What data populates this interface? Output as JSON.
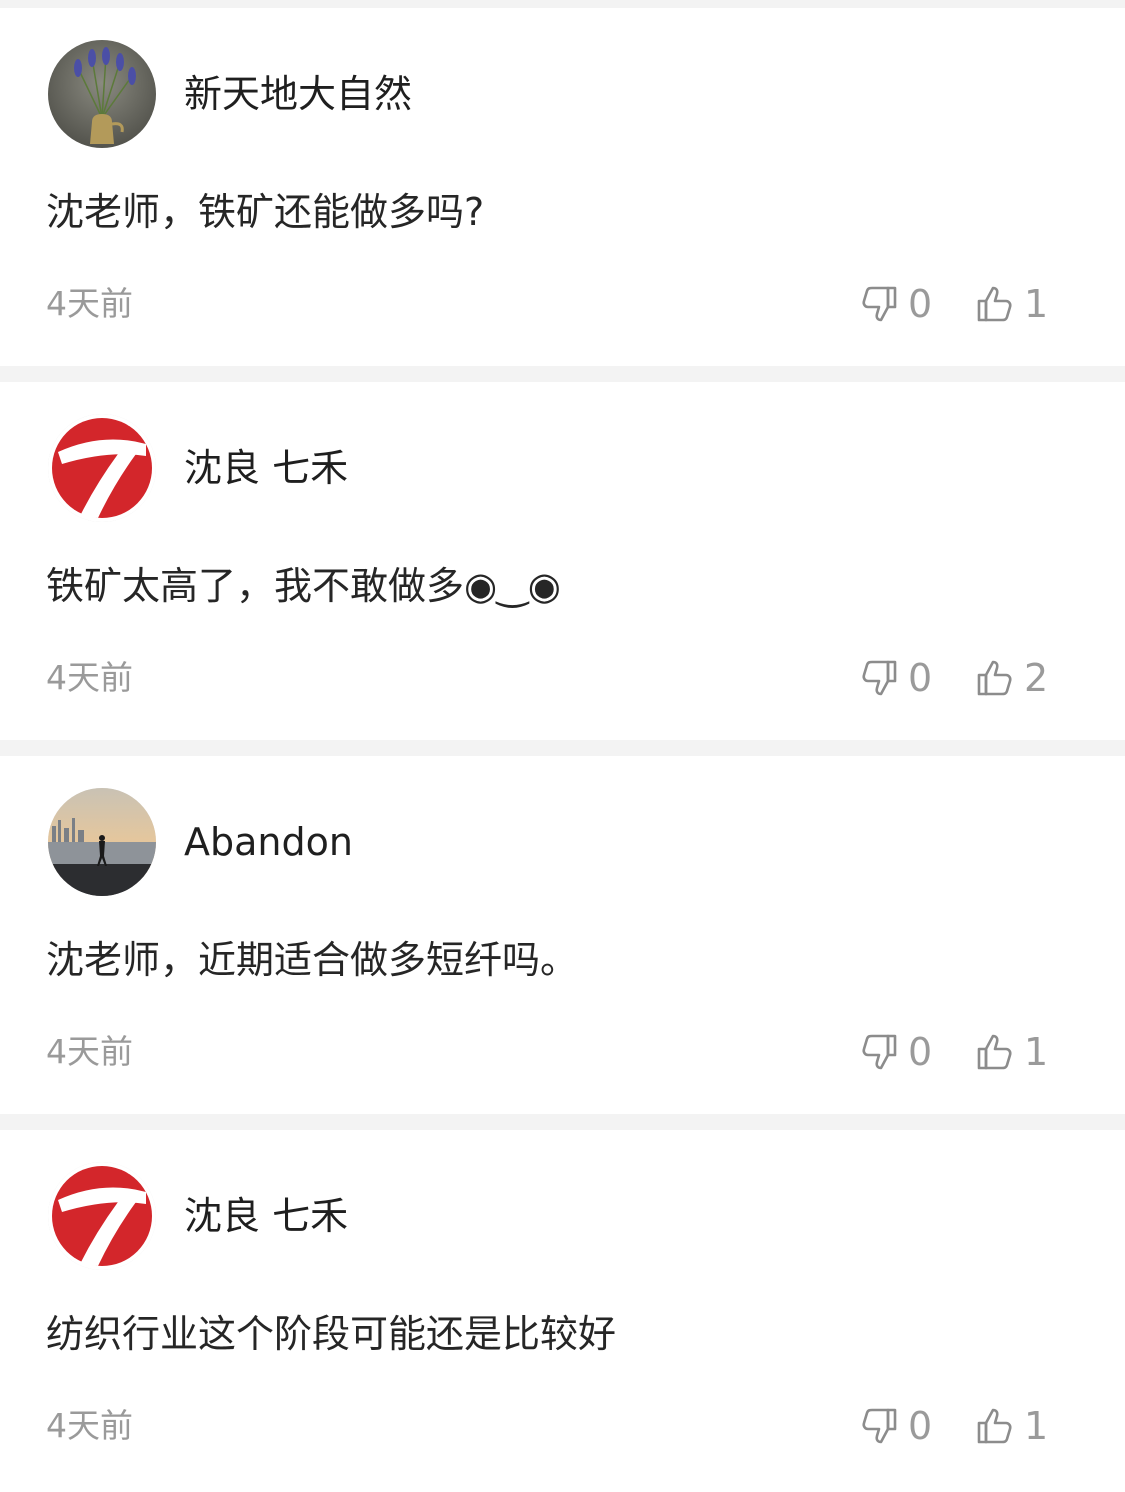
{
  "comments": [
    {
      "username": "新天地大自然",
      "content": "沈老师，铁矿还能做多吗?",
      "time": "4天前",
      "dislikes": "0",
      "likes": "1",
      "avatar": "vase-flowers-avatar"
    },
    {
      "username": "沈良 七禾",
      "content": "铁矿太高了，我不敢做多◉‿◉",
      "time": "4天前",
      "dislikes": "0",
      "likes": "2",
      "avatar": "red-seven-logo-avatar"
    },
    {
      "username": "Abandon",
      "content": "沈老师，近期适合做多短纤吗。",
      "time": "4天前",
      "dislikes": "0",
      "likes": "1",
      "avatar": "sunset-silhouette-avatar"
    },
    {
      "username": "沈良 七禾",
      "content": "纺织行业这个阶段可能还是比较好",
      "time": "4天前",
      "dislikes": "0",
      "likes": "1",
      "avatar": "red-seven-logo-avatar"
    }
  ],
  "colors": {
    "background": "#f3f3f3",
    "card": "#ffffff",
    "text_primary": "#1f1f1f",
    "text_secondary": "#9a9a9a",
    "logo_red": "#d3262b"
  }
}
